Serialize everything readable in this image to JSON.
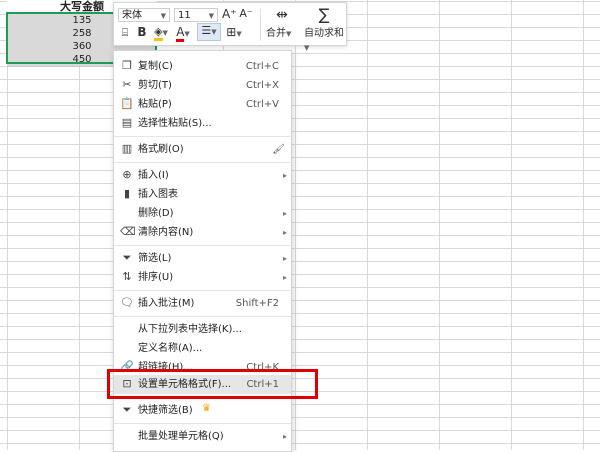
{
  "sheet": {
    "column_header": "大写金额",
    "cells": [
      "135",
      "258",
      "360",
      "450"
    ]
  },
  "toolbar": {
    "font_name": "宋体",
    "font_size": "11",
    "increase_font": "A⁺",
    "decrease_font": "A⁻",
    "bold": "B",
    "merge_label": "合并",
    "autosum_label": "自动求和",
    "merge_icon": "merge-cells-icon",
    "sum_icon": "sigma-icon"
  },
  "menu": {
    "copy": {
      "label": "复制(C)",
      "shortcut": "Ctrl+C"
    },
    "cut": {
      "label": "剪切(T)",
      "shortcut": "Ctrl+X"
    },
    "paste": {
      "label": "粘贴(P)",
      "shortcut": "Ctrl+V"
    },
    "paste_special": {
      "label": "选择性粘贴(S)..."
    },
    "format_painter": {
      "label": "格式刷(O)"
    },
    "insert": {
      "label": "插入(I)"
    },
    "insert_chart": {
      "label": "插入图表"
    },
    "delete": {
      "label": "删除(D)"
    },
    "clear": {
      "label": "清除内容(N)"
    },
    "filter": {
      "label": "筛选(L)"
    },
    "sort": {
      "label": "排序(U)"
    },
    "insert_comment": {
      "label": "插入批注(M)",
      "shortcut": "Shift+F2"
    },
    "pick_from_list": {
      "label": "从下拉列表中选择(K)..."
    },
    "define_name": {
      "label": "定义名称(A)..."
    },
    "hyperlink": {
      "label": "超链接(H)...",
      "shortcut": "Ctrl+K"
    },
    "format_cells": {
      "label": "设置单元格格式(F)...",
      "shortcut": "Ctrl+1"
    },
    "quick_filter": {
      "label": "快捷筛选(B)"
    },
    "batch_process": {
      "label": "批量处理单元格(Q)"
    }
  },
  "colors": {
    "selection_border": "#1e9b54",
    "highlight_box": "#e00000",
    "selected_cell_bg": "#d9d9d9"
  }
}
